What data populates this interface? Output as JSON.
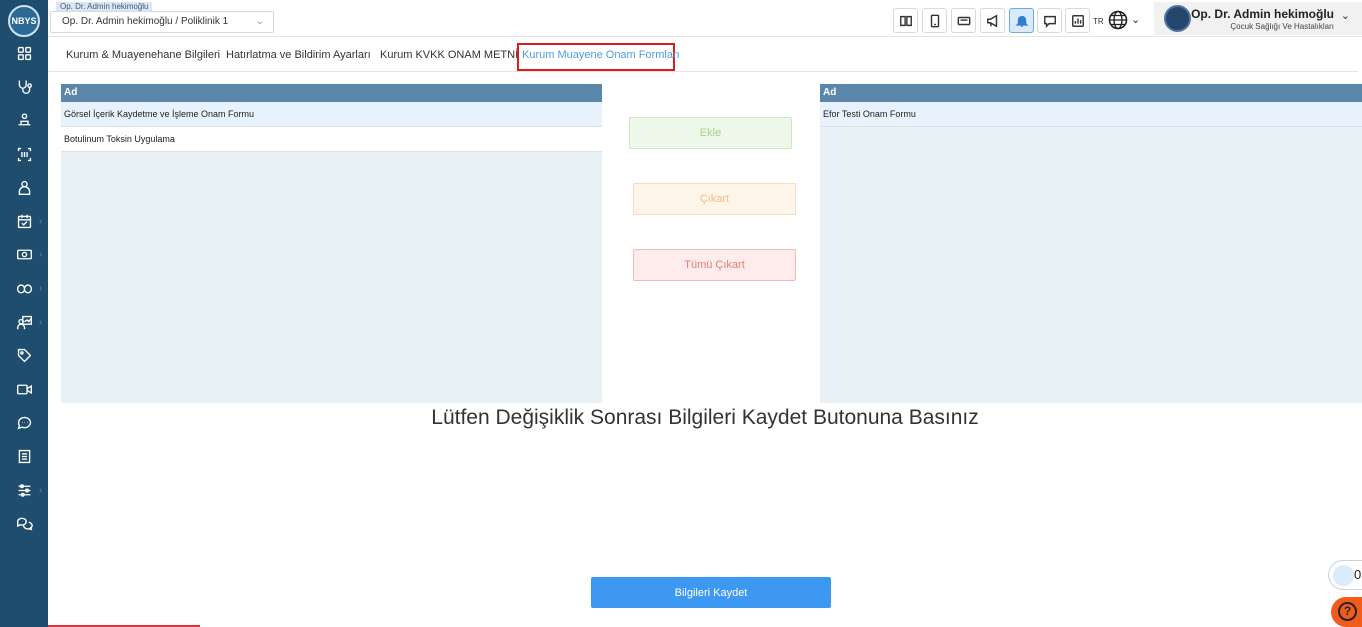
{
  "app": {
    "logo_text": "NBYS"
  },
  "sidebar": {
    "items": [
      {
        "icon": "grid-icon"
      },
      {
        "icon": "stethoscope-icon"
      },
      {
        "icon": "patient-bed-icon"
      },
      {
        "icon": "barcode-scan-icon"
      },
      {
        "icon": "nurse-icon"
      },
      {
        "icon": "calendar-check-icon",
        "has_submenu": true
      },
      {
        "icon": "cash-icon",
        "has_submenu": true
      },
      {
        "icon": "pills-icon",
        "has_submenu": true
      },
      {
        "icon": "doctor-chart-icon",
        "has_submenu": true
      },
      {
        "icon": "tag-icon"
      },
      {
        "icon": "video-icon"
      },
      {
        "icon": "chat-bubble-icon"
      },
      {
        "icon": "book-icon"
      },
      {
        "icon": "sliders-icon",
        "has_submenu": true
      },
      {
        "icon": "conversation-icon"
      }
    ]
  },
  "header": {
    "context_tag": "Op. Dr. Admin hekimoğlu",
    "context_select": "Op. Dr. Admin hekimoğlu / Poliklinik 1",
    "toolbar_icons": [
      "book-open-icon",
      "tablet-icon",
      "id-card-icon",
      "megaphone-icon",
      "bell-icon",
      "message-icon",
      "report-icon"
    ],
    "active_toolbar_icon": "bell-icon",
    "language": "TR",
    "user": {
      "name": "Op. Dr. Admin hekimoğlu",
      "department": "Çocuk Sağlığı Ve Hastalıkları"
    }
  },
  "tabs": [
    {
      "label": "Kurum & Muayenehane Bilgileri",
      "active": false
    },
    {
      "label": "Hatırlatma ve Bildirim Ayarları",
      "active": false
    },
    {
      "label": "Kurum KVKK ONAM METNİ",
      "active": false
    },
    {
      "label": "Kurum Muayene Onam Formları",
      "active": true
    }
  ],
  "left_list": {
    "header": "Ad",
    "rows": [
      "Görsel İçerik Kaydetme ve İşleme Onam Formu",
      "Botulinum Toksin Uygulama"
    ]
  },
  "right_list": {
    "header": "Ad",
    "rows": [
      "Efor Testi Onam Formu"
    ]
  },
  "actions": {
    "add": "Ekle",
    "remove": "Çıkart",
    "remove_all": "Tümü Çıkart"
  },
  "notice": "Lütfen Değişiklik Sonrası Bilgileri Kaydet Butonuna Basınız",
  "save_button": "Bilgileri Kaydet",
  "online_count": "0",
  "help_icon": "?",
  "colors": {
    "sidebar": "#1f4d6e",
    "table_header": "#5b87ab",
    "primary": "#3c98f0",
    "highlight": "#e01b1b"
  }
}
